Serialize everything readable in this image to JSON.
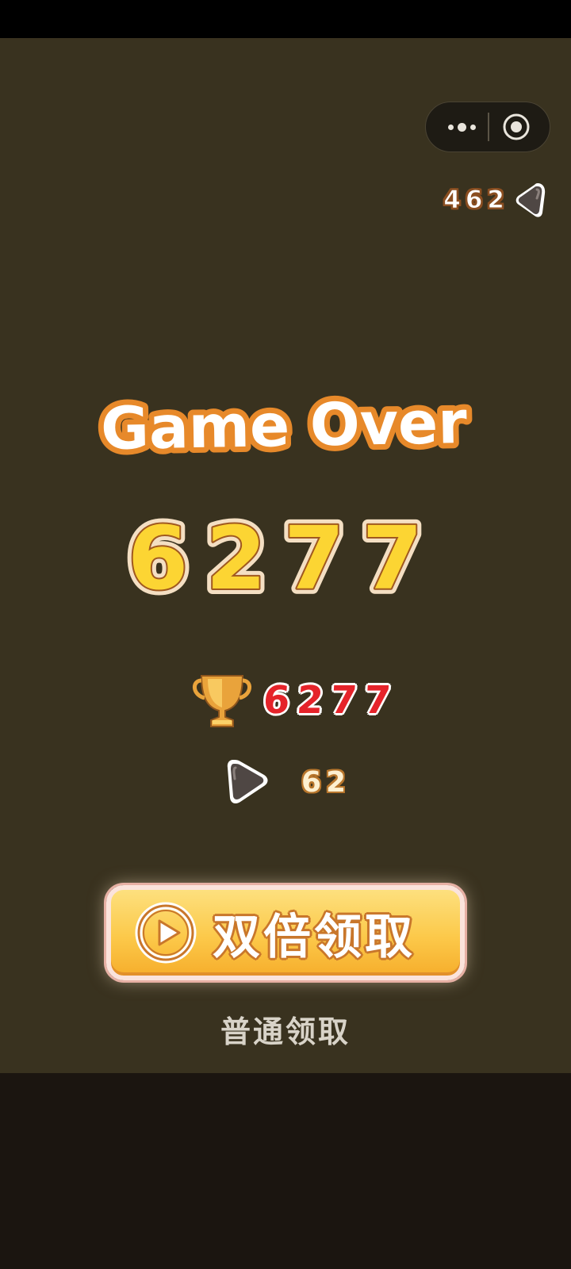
{
  "gems": {
    "count": "462",
    "icon": "gem-icon"
  },
  "title": "Game Over",
  "score": "6277",
  "best": {
    "icon": "trophy-icon",
    "value": "6277"
  },
  "reward": {
    "icon": "gem-icon",
    "value": "62"
  },
  "buttons": {
    "double_label": "双倍领取",
    "normal_label": "普通领取"
  },
  "colors": {
    "panel": "#39321f",
    "title_outline": "#e7892a",
    "score_fill": "#fcd533",
    "best_red": "#e5232a",
    "button_yellow": "#fcc94a"
  }
}
